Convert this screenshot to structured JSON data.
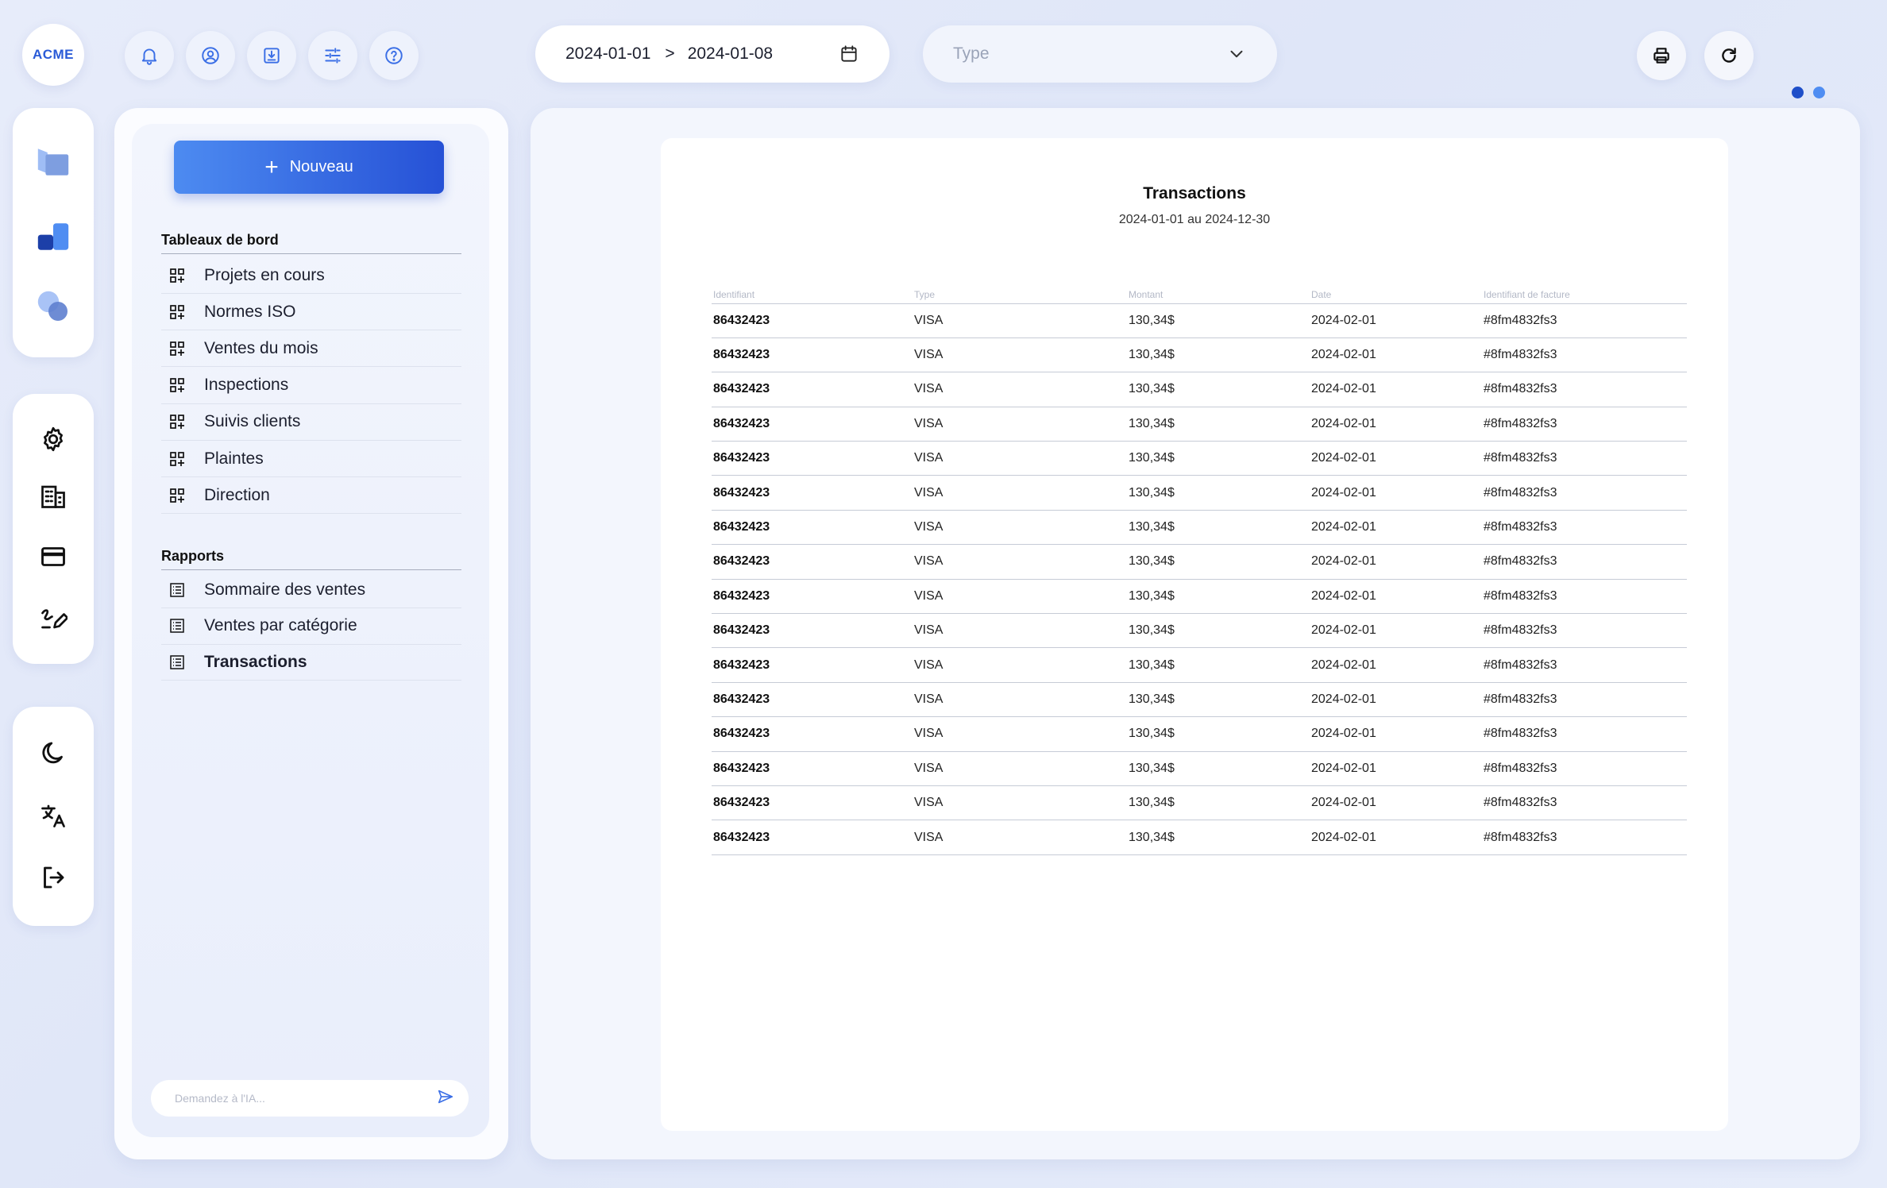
{
  "app": {
    "logo_text": "ACME"
  },
  "toolbar": {
    "icons": [
      "bell-icon",
      "user-circle-icon",
      "download-icon",
      "sliders-icon",
      "help-icon"
    ],
    "date_start": "2024-01-01",
    "date_separator": ">",
    "date_end": "2024-01-08",
    "type_placeholder": "Type",
    "right_icons": [
      "print-icon",
      "refresh-icon"
    ]
  },
  "pager": {
    "active_color": "#1f4fc9",
    "inactive_color": "#4f8df2"
  },
  "rail": {
    "group1": [
      "folder-icon",
      "blocks-icon",
      "circles-icon"
    ],
    "group2": [
      "gear-icon",
      "building-icon",
      "credit-card-icon",
      "pen-edit-icon"
    ],
    "group3": [
      "moon-icon",
      "translate-icon",
      "logout-icon"
    ]
  },
  "sidebar": {
    "new_label": "Nouveau",
    "dashboards_title": "Tableaux de bord",
    "dashboards": [
      {
        "label": "Projets en cours"
      },
      {
        "label": "Normes ISO"
      },
      {
        "label": "Ventes du mois"
      },
      {
        "label": "Inspections"
      },
      {
        "label": "Suivis clients"
      },
      {
        "label": "Plaintes"
      },
      {
        "label": "Direction"
      }
    ],
    "reports_title": "Rapports",
    "reports": [
      {
        "label": "Sommaire des ventes"
      },
      {
        "label": "Ventes par catégorie"
      },
      {
        "label": "Transactions"
      }
    ],
    "active_report": "Transactions",
    "ai_placeholder": "Demandez à l'IA..."
  },
  "report": {
    "title": "Transactions",
    "subtitle": "2024-01-01 au 2024-12-30",
    "columns": [
      "Identifiant",
      "Type",
      "Montant",
      "Date",
      "Identifiant de facture"
    ],
    "rows": [
      [
        "86432423",
        "VISA",
        "130,34$",
        "2024-02-01",
        "#8fm4832fs3"
      ],
      [
        "86432423",
        "VISA",
        "130,34$",
        "2024-02-01",
        "#8fm4832fs3"
      ],
      [
        "86432423",
        "VISA",
        "130,34$",
        "2024-02-01",
        "#8fm4832fs3"
      ],
      [
        "86432423",
        "VISA",
        "130,34$",
        "2024-02-01",
        "#8fm4832fs3"
      ],
      [
        "86432423",
        "VISA",
        "130,34$",
        "2024-02-01",
        "#8fm4832fs3"
      ],
      [
        "86432423",
        "VISA",
        "130,34$",
        "2024-02-01",
        "#8fm4832fs3"
      ],
      [
        "86432423",
        "VISA",
        "130,34$",
        "2024-02-01",
        "#8fm4832fs3"
      ],
      [
        "86432423",
        "VISA",
        "130,34$",
        "2024-02-01",
        "#8fm4832fs3"
      ],
      [
        "86432423",
        "VISA",
        "130,34$",
        "2024-02-01",
        "#8fm4832fs3"
      ],
      [
        "86432423",
        "VISA",
        "130,34$",
        "2024-02-01",
        "#8fm4832fs3"
      ],
      [
        "86432423",
        "VISA",
        "130,34$",
        "2024-02-01",
        "#8fm4832fs3"
      ],
      [
        "86432423",
        "VISA",
        "130,34$",
        "2024-02-01",
        "#8fm4832fs3"
      ],
      [
        "86432423",
        "VISA",
        "130,34$",
        "2024-02-01",
        "#8fm4832fs3"
      ],
      [
        "86432423",
        "VISA",
        "130,34$",
        "2024-02-01",
        "#8fm4832fs3"
      ],
      [
        "86432423",
        "VISA",
        "130,34$",
        "2024-02-01",
        "#8fm4832fs3"
      ],
      [
        "86432423",
        "VISA",
        "130,34$",
        "2024-02-01",
        "#8fm4832fs3"
      ]
    ]
  },
  "colors": {
    "accent": "#2f63e0",
    "icon_blue": "#3b6fe6"
  }
}
